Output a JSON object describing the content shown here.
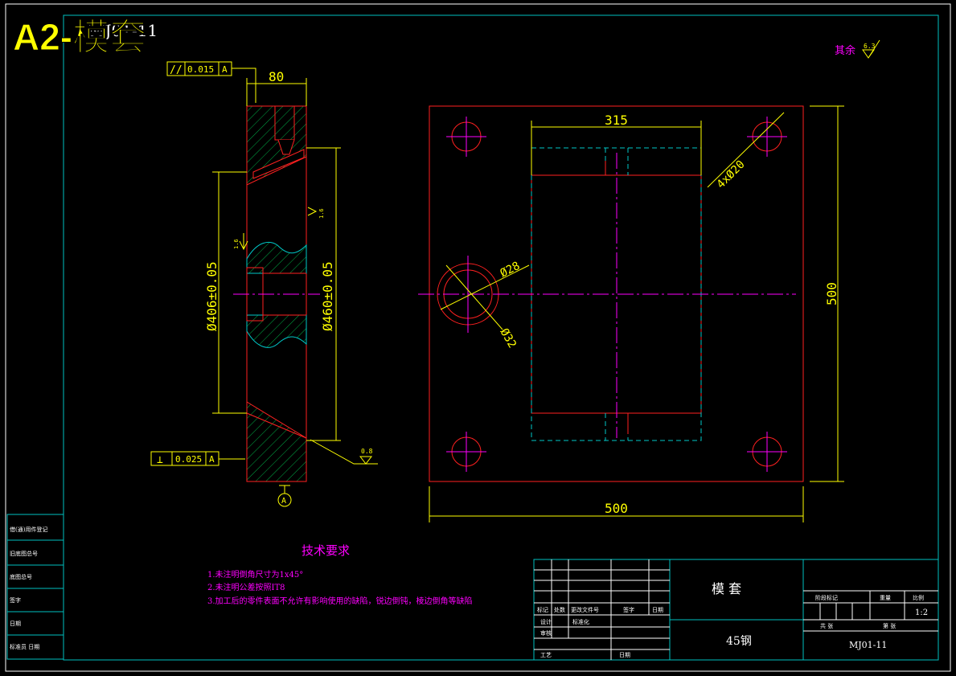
{
  "sheet": {
    "title": "A2-模套",
    "overlay_text": "MJ01-11",
    "roughness_note_label": "其余",
    "roughness_note_value": "6.3"
  },
  "colors": {
    "frame": "#00c0c0",
    "part": "#ff2020",
    "dimension": "#ffff00",
    "centerline": "#ff00ff",
    "hatch": "#00aa44",
    "text_white": "#ffffff"
  },
  "section_view": {
    "dim_width": "80",
    "dim_inner_dia": "Ø406±0.05",
    "dim_outer_dia": "Ø460±0.05",
    "tol_parallel_symbol": "//",
    "tol_parallel_value": "0.015",
    "tol_parallel_datum": "A",
    "tol_perp_symbol": "⊥",
    "tol_perp_value": "0.025",
    "tol_perp_datum": "A",
    "datum_label": "A",
    "roughness_1": "1.6",
    "roughness_2": "1.6",
    "roughness_3": "0.8"
  },
  "plan_view": {
    "dim_top": "315",
    "dim_holes": "4xØ20",
    "dim_d28": "Ø28",
    "dim_d32": "Ø32",
    "dim_height": "500",
    "dim_width": "500"
  },
  "tech_requirements": {
    "heading": "技术要求",
    "items": [
      "1.未注明倒角尺寸为1x45°",
      "2.未注明公差按照IT8",
      "3.加工后的零件表面不允许有影响使用的缺陷，锐边倒钝，棱边倒角等缺陷"
    ]
  },
  "left_strip": {
    "rows": [
      "借(通)用件登记",
      "旧底图总号",
      "底图总号",
      "签字",
      "日期",
      "标准员 日期"
    ]
  },
  "title_block": {
    "part_name": "模 套",
    "material": "45钢",
    "scale": "1:2",
    "drawing_no": "MJ01-11",
    "labels": {
      "mark": "标记",
      "count": "处数",
      "change_doc": "更改文件号",
      "sign": "签字",
      "date": "日期",
      "design": "设计",
      "standardize": "标准化",
      "review": "审核",
      "process": "工艺",
      "date2": "日期",
      "stage_mark": "阶段标记",
      "weight": "重量",
      "ratio": "比例",
      "sheets_total": "共 张",
      "sheet_no": "第 张"
    }
  }
}
